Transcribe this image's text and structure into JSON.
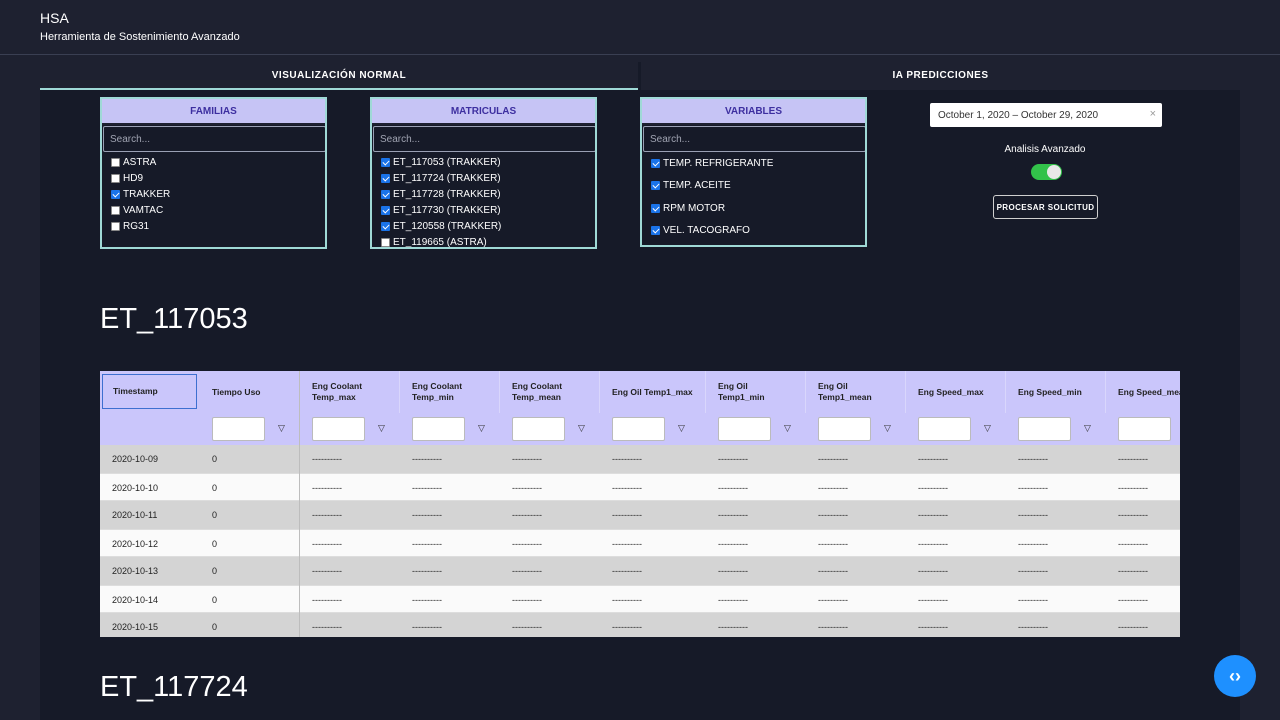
{
  "header": {
    "title": "HSA",
    "subtitle": "Herramienta de Sostenimiento Avanzado"
  },
  "tabs": [
    {
      "label": "VISUALIZACIÓN NORMAL",
      "active": true
    },
    {
      "label": "IA PREDICCIONES",
      "active": false
    }
  ],
  "filters": {
    "familias": {
      "title": "FAMILIAS",
      "placeholder": "Search...",
      "options": [
        {
          "label": "ASTRA",
          "checked": false
        },
        {
          "label": "HD9",
          "checked": false
        },
        {
          "label": "TRAKKER",
          "checked": true
        },
        {
          "label": "VAMTAC",
          "checked": false
        },
        {
          "label": "RG31",
          "checked": false
        }
      ]
    },
    "matriculas": {
      "title": "MATRICULAS",
      "placeholder": "Search...",
      "options": [
        {
          "label": "ET_117053 (TRAKKER)",
          "checked": true
        },
        {
          "label": "ET_117724 (TRAKKER)",
          "checked": true
        },
        {
          "label": "ET_117728 (TRAKKER)",
          "checked": true
        },
        {
          "label": "ET_117730 (TRAKKER)",
          "checked": true
        },
        {
          "label": "ET_120558 (TRAKKER)",
          "checked": true
        },
        {
          "label": "ET_119665 (ASTRA)",
          "checked": false
        }
      ]
    },
    "variables": {
      "title": "VARIABLES",
      "placeholder": "Search...",
      "options": [
        {
          "label": "TEMP. REFRIGERANTE",
          "checked": true
        },
        {
          "label": "TEMP. ACEITE",
          "checked": true
        },
        {
          "label": "RPM MOTOR",
          "checked": true
        },
        {
          "label": "VEL. TACOGRAFO",
          "checked": true
        }
      ]
    }
  },
  "date_range": {
    "value": "October 1, 2020 – October 29, 2020",
    "clear": "×"
  },
  "advanced": {
    "label": "Analisis Avanzado",
    "enabled": true
  },
  "process_button": "PROCESAR SOLICITUD",
  "sections": [
    {
      "title": "ET_117053"
    },
    {
      "title": "ET_117724"
    }
  ],
  "table": {
    "columns": [
      "Timestamp",
      "Tiempo Uso",
      "Eng Coolant\nTemp_max",
      "Eng Coolant\nTemp_min",
      "Eng Coolant\nTemp_mean",
      "Eng Oil Temp1_max",
      "Eng Oil\nTemp1_min",
      "Eng Oil\nTemp1_mean",
      "Eng Speed_max",
      "Eng Speed_min",
      "Eng Speed_mean"
    ],
    "filter_icon": "▽",
    "rows": [
      [
        "2020-10-09",
        "0",
        "----------",
        "----------",
        "----------",
        "----------",
        "----------",
        "----------",
        "----------",
        "----------",
        "----------"
      ],
      [
        "2020-10-10",
        "0",
        "----------",
        "----------",
        "----------",
        "----------",
        "----------",
        "----------",
        "----------",
        "----------",
        "----------"
      ],
      [
        "2020-10-11",
        "0",
        "----------",
        "----------",
        "----------",
        "----------",
        "----------",
        "----------",
        "----------",
        "----------",
        "----------"
      ],
      [
        "2020-10-12",
        "0",
        "----------",
        "----------",
        "----------",
        "----------",
        "----------",
        "----------",
        "----------",
        "----------",
        "----------"
      ],
      [
        "2020-10-13",
        "0",
        "----------",
        "----------",
        "----------",
        "----------",
        "----------",
        "----------",
        "----------",
        "----------",
        "----------"
      ],
      [
        "2020-10-14",
        "0",
        "----------",
        "----------",
        "----------",
        "----------",
        "----------",
        "----------",
        "----------",
        "----------",
        "----------"
      ],
      [
        "2020-10-15",
        "0",
        "----------",
        "----------",
        "----------",
        "----------",
        "----------",
        "----------",
        "----------",
        "----------",
        "----------"
      ]
    ]
  },
  "fab": {
    "icon": "code-icon",
    "glyph": "‹›"
  }
}
